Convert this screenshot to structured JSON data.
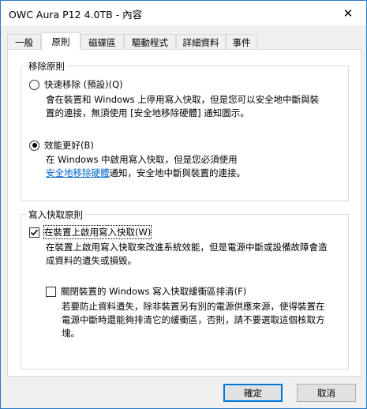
{
  "window": {
    "title": "OWC Aura P12 4.0TB - 內容",
    "close_glyph": "✕"
  },
  "tabs": [
    {
      "label": "一般",
      "active": false
    },
    {
      "label": "原則",
      "active": true
    },
    {
      "label": "磁碟區",
      "active": false
    },
    {
      "label": "驅動程式",
      "active": false
    },
    {
      "label": "詳細資料",
      "active": false
    },
    {
      "label": "事件",
      "active": false
    }
  ],
  "removal_policy": {
    "legend": "移除原則",
    "quick_removal": {
      "label": "快速移除 (預設)(Q)",
      "selected": false,
      "desc_line1": "會在裝置和 Windows 上停用寫入快取，但是您可以安全地中斷與裝",
      "desc_line2": "置的連接，無須使用 [安全地移除硬體] 通知圖示。"
    },
    "better_performance": {
      "label": "效能更好(B)",
      "selected": true,
      "desc_line1": "在 Windows 中啟用寫入快取，但是您必須使用",
      "desc_link": "安全地移除硬體",
      "desc_line2_rest": "通知，安全地中斷與裝置的連接。"
    }
  },
  "write_cache_policy": {
    "legend": "寫入快取原則",
    "enable_write_cache": {
      "label": "在裝置上啟用寫入快取(W)",
      "checked": true,
      "desc_line1": "在裝置上啟用寫入快取來改進系統效能，但是電源中斷或設備故障會造",
      "desc_line2": "成資料的遺失或損毀。"
    },
    "turn_off_flushing": {
      "label": "關閉裝置的 Windows 寫入快取緩衝區排清(F)",
      "checked": false,
      "desc_line1": "若要防止資料遺失，除非裝置另有別的電源供應來源，使得裝置在",
      "desc_line2": "電源中斷時還能夠排清它的緩衝區，否則，請不要選取這個核取方",
      "desc_line3": "塊。"
    }
  },
  "buttons": {
    "ok": "確定",
    "cancel": "取消"
  }
}
